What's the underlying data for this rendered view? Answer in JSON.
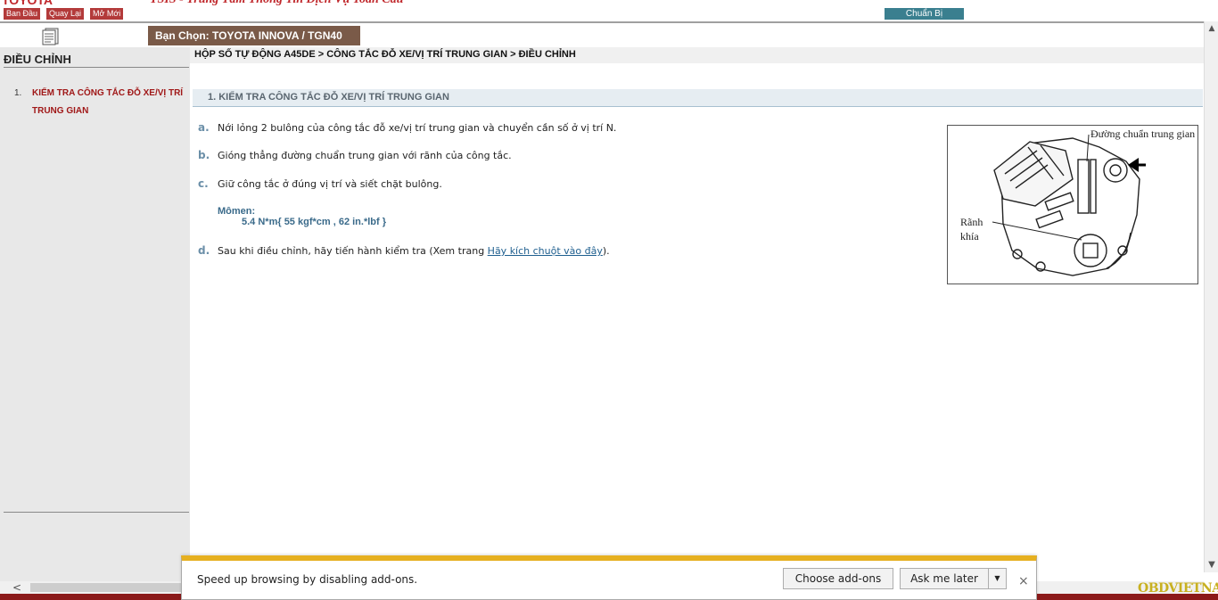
{
  "header": {
    "logo_text": "TOYOTA",
    "title": "TSIS - Trung Tâm Thông Tin Dịch Vụ Toàn Cầu",
    "buttons": [
      "Ban Đầu",
      "Quay Lại",
      "Mở Mới"
    ],
    "prepare_label": "Chuẩn Bị",
    "vehicle": "Bạn Chọn: TOYOTA INNOVA / TGN40"
  },
  "sidebar": {
    "title": "ĐIỀU CHỈNH",
    "items": [
      {
        "number": "1.",
        "label": "KIỂM TRA CÔNG TẮC ĐỖ XE/VỊ TRÍ TRUNG GIAN"
      }
    ]
  },
  "main": {
    "breadcrumb": "HỘP SỐ TỰ ĐỘNG A45DE > CÔNG TẮC ĐỖ XE/VỊ TRÍ TRUNG GIAN > ĐIỀU CHỈNH",
    "section_title": "1. KIỂM TRA CÔNG TẮC ĐỖ XE/VỊ TRÍ TRUNG GIAN",
    "steps": [
      {
        "letter": "a.",
        "text": "Nới lỏng 2 bulông của công tắc đỗ xe/vị trí trung gian và chuyển cần số ở vị trí N."
      },
      {
        "letter": "b.",
        "text": "Gióng thẳng đường chuẩn trung gian với rãnh của công tắc."
      },
      {
        "letter": "c.",
        "text": "Giữ công tắc ở đúng vị trí và siết chặt bulông."
      },
      {
        "letter": "d.",
        "text": "Sau khi điều chỉnh, hãy tiến hành kiểm tra (Xem trang ",
        "link": "Hãy kích chuột vào đây",
        "suffix": ")."
      }
    ],
    "torque_label": "Mômen:",
    "torque_value": "5.4 N*m{ 55 kgf*cm , 62 in.*lbf }",
    "figure": {
      "label_top": "Đường chuẩn trung gian",
      "label_left": "Rãnh khía"
    }
  },
  "notification": {
    "message": "Speed up browsing by disabling add-ons.",
    "choose_label": "Choose add-ons",
    "later_label": "Ask me later",
    "close": "×"
  },
  "watermark": "OBDVIETNAM",
  "colors": {
    "brand_red": "#c0282c",
    "button_red": "#b33a3a",
    "prepare_teal": "#3a7f8f",
    "vehicle_brown": "#7a5a48",
    "notif_yellow": "#e6b020"
  }
}
